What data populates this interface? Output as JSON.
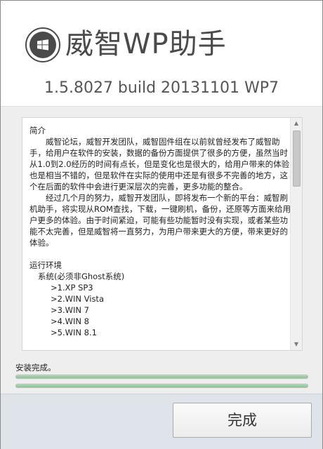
{
  "header": {
    "title": "威智WP助手",
    "version": "1.5.8027 build 20131101 WP7",
    "logo_icon": "windows-phone-logo-icon"
  },
  "readme": {
    "intro_heading": "简介",
    "paragraph1": "威智论坛，威智开发团队，威智固件组在以前就曾经发布了威智助手，给用户在软件的安装，数据的备份方面提供了很多的方便，虽然当时从1.0到2.0经历的时间有点长，但是变化也是很大的，给用户带来的体验也是相当不错的，但是软件在实际的使用中还是有很多不完善的地方，这个在后面的软件中会进行更深层次的完善，更多功能的整合。",
    "paragraph2": "经过几个月的努力，威智开发团队，即将发布一个新的平台：威智刷机助手，将实现从ROM查找，下载，一键刷机，备份，还原等方面来给用户更多的体验。由于时间紧迫，可能有些功能暂时没有实现，或者某些功能不太完善，但是威智将一直努力，为用户带来更大的方便，带来更好的体验。",
    "env_heading": "运行环境",
    "system_label": "系统(必须非Ghost系统)",
    "systems": [
      ">1.XP SP3",
      ">2.WIN Vista",
      ">3.WIN 7",
      ">4.WIN 8",
      ">5.WIN 8.1"
    ]
  },
  "status": {
    "text": "安装完成。",
    "progress1": 1.0,
    "progress2": 1.0
  },
  "footer": {
    "done_label": "完成"
  },
  "colors": {
    "progress_fill": "#8fc89a",
    "footer_bg": "#dfe3ea",
    "mid_bg": "#eeeeee",
    "title_color": "#4a4a4a"
  }
}
